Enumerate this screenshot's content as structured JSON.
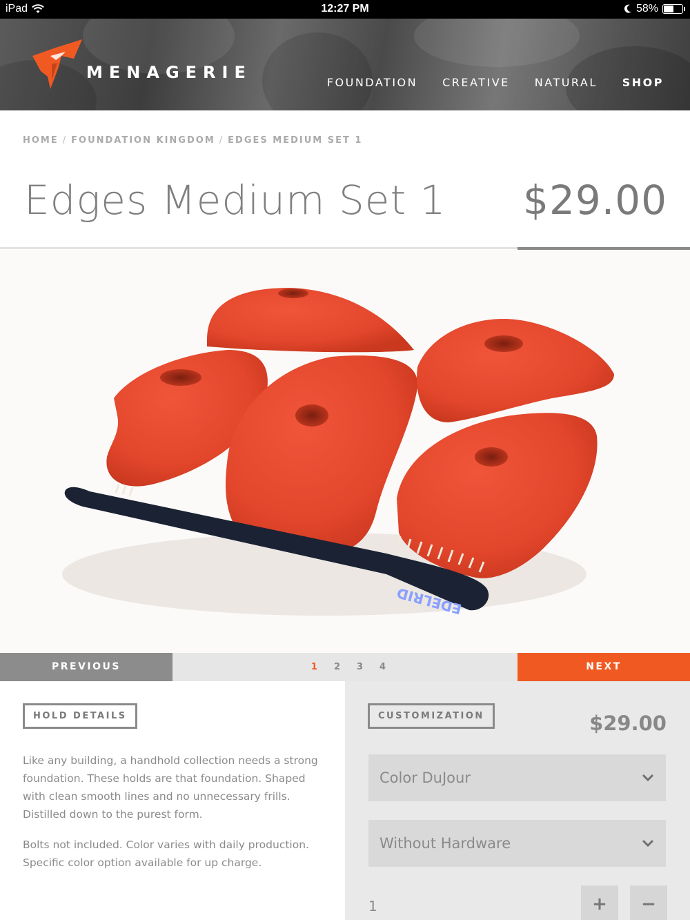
{
  "status_bar": {
    "device": "iPad",
    "time": "12:27 PM",
    "battery": "58%",
    "battery_level": 0.58
  },
  "header": {
    "brand": "MENAGERIE",
    "nav": [
      "FOUNDATION",
      "CREATIVE",
      "NATURAL",
      "SHOP"
    ],
    "active_nav": "SHOP"
  },
  "breadcrumb": [
    "HOME",
    "FOUNDATION KINGDOM",
    "EDGES MEDIUM SET 1"
  ],
  "product": {
    "title": "Edges Medium Set 1",
    "price": "$29.00",
    "brush_text": "EDELRID"
  },
  "pager": {
    "previous": "PREVIOUS",
    "next": "NEXT",
    "pages": [
      "1",
      "2",
      "3",
      "4"
    ],
    "current_page": "1"
  },
  "details": {
    "heading": "HOLD DETAILS",
    "description": "Like any building, a handhold collection needs a strong foundation. These holds are that foundation. Shaped with clean smooth lines and no unnecessary frills. Distilled down to the purest form.",
    "note": "Bolts not included. Color varies with daily production. Specific color option available for up charge."
  },
  "customization": {
    "heading": "CUSTOMIZATION",
    "price": "$29.00",
    "color_select": "Color DuJour",
    "hardware_select": "Without Hardware",
    "quantity": "1",
    "increment_label": "+",
    "decrement_label": "−"
  },
  "colors": {
    "accent": "#f05a22",
    "grey_button": "#8c8c8c",
    "panel": "#e9e9e9",
    "hold_red": "#e8472c"
  }
}
